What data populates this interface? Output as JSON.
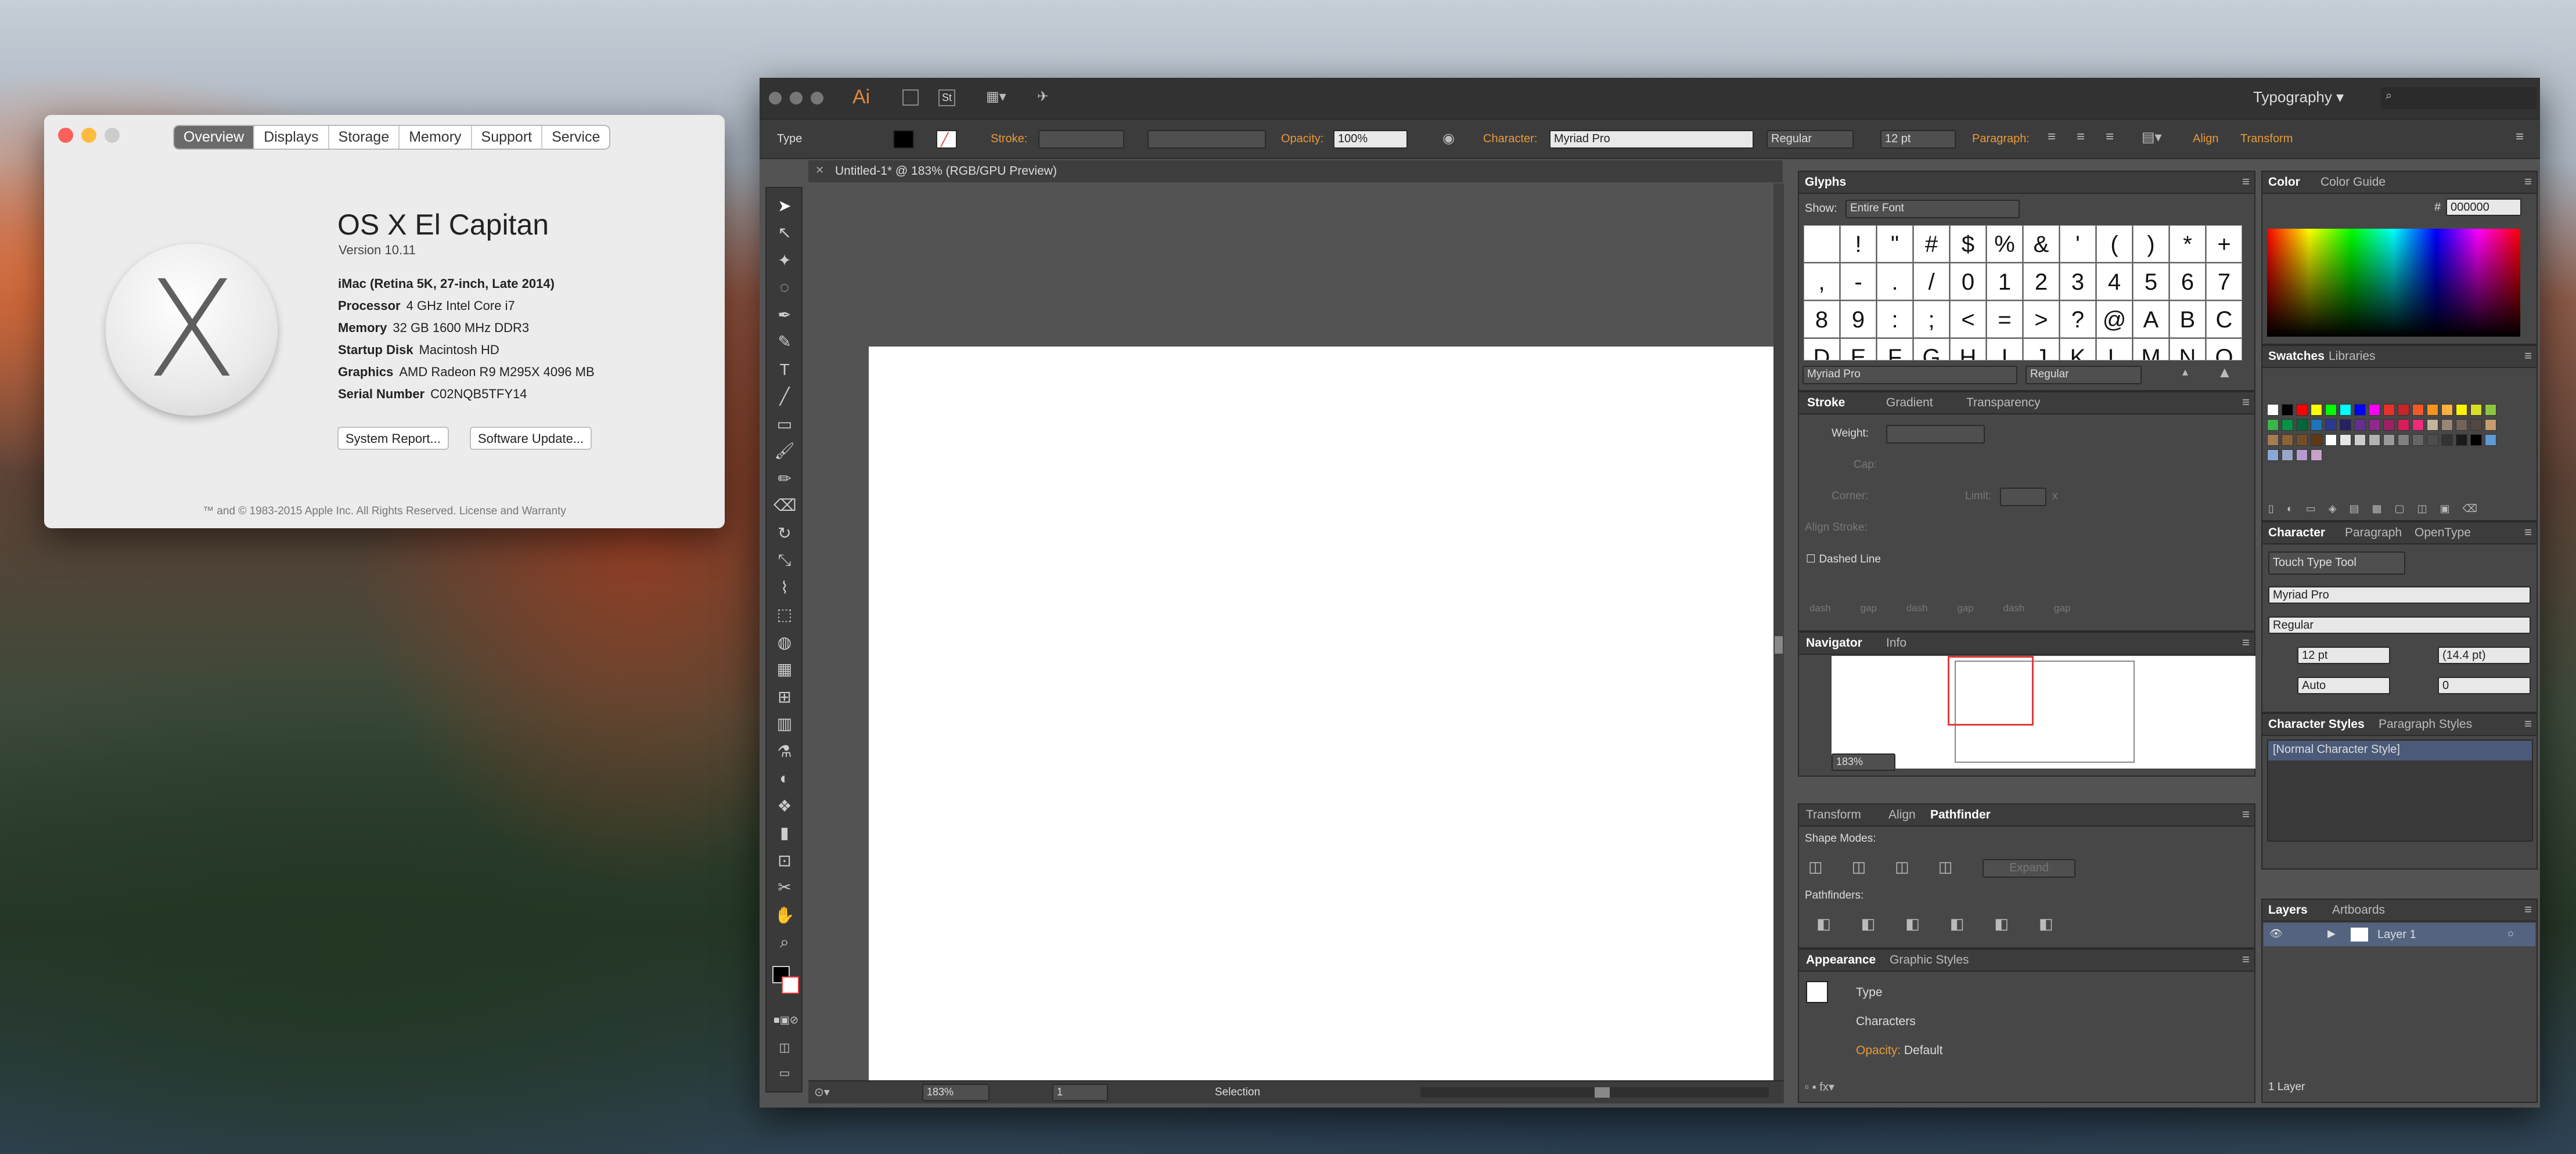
{
  "about": {
    "tabs": [
      "Overview",
      "Displays",
      "Storage",
      "Memory",
      "Support",
      "Service"
    ],
    "os_name": "OS X El Capitan",
    "version": "Version 10.11",
    "model": "iMac (Retina 5K, 27-inch, Late 2014)",
    "specs": [
      {
        "k": "Processor",
        "v": "4 GHz Intel Core i7"
      },
      {
        "k": "Memory",
        "v": "32 GB 1600 MHz DDR3"
      },
      {
        "k": "Startup Disk",
        "v": "Macintosh HD"
      },
      {
        "k": "Graphics",
        "v": "AMD Radeon R9 M295X 4096 MB"
      },
      {
        "k": "Serial Number",
        "v": "C02NQB5TFY14"
      }
    ],
    "buttons": {
      "report": "System Report...",
      "update": "Software Update..."
    },
    "logo": "X",
    "footer": "™ and © 1983-2015 Apple Inc. All Rights Reserved. License and Warranty"
  },
  "ai": {
    "logo": "Ai",
    "st": "St",
    "workspace": "Typography",
    "search_placeholder": "",
    "control": {
      "type_label": "Type",
      "stroke_label": "Stroke:",
      "opacity_label": "Opacity:",
      "opacity": "100%",
      "character_label": "Character:",
      "font": "Myriad Pro",
      "style": "Regular",
      "size": "12 pt",
      "paragraph_label": "Paragraph:",
      "align": "Align",
      "transform": "Transform"
    },
    "doc_tab": "Untitled-1* @ 183% (RGB/GPU Preview)",
    "status": {
      "zoom": "183%",
      "page": "1",
      "tool": "Selection"
    },
    "glyphs": {
      "title": "Glyphs",
      "show_label": "Show:",
      "show": "Entire Font",
      "chars": [
        "",
        "!",
        "\"",
        "#",
        "$",
        "%",
        "&",
        "'",
        "(",
        ")",
        "*",
        "+",
        ",",
        "-",
        ".",
        "/",
        "0",
        "1",
        "2",
        "3",
        "4",
        "5",
        "6",
        "7",
        "8",
        "9",
        ":",
        ";",
        "<",
        "=",
        ">",
        "?",
        "@",
        "A",
        "B",
        "C",
        "D",
        "E",
        "F",
        "G",
        "H",
        "I",
        "J",
        "K",
        "L",
        "M",
        "N",
        "O"
      ],
      "font": "Myriad Pro",
      "style": "Regular"
    },
    "stroke": {
      "tabs": [
        "Stroke",
        "Gradient",
        "Transparency"
      ],
      "weight": "Weight:",
      "cap": "Cap:",
      "corner": "Corner:",
      "limit": "Limit:",
      "limit_x": "x",
      "align": "Align Stroke:",
      "dashed": "Dashed Line",
      "dash_labels": [
        "dash",
        "gap",
        "dash",
        "gap",
        "dash",
        "gap"
      ]
    },
    "navigator": {
      "tabs": [
        "Navigator",
        "Info"
      ],
      "zoom": "183%"
    },
    "pathfinder": {
      "tabs": [
        "Transform",
        "Align",
        "Pathfinder"
      ],
      "shape_modes": "Shape Modes:",
      "expand": "Expand",
      "pathfinders": "Pathfinders:"
    },
    "appearance": {
      "tabs": [
        "Appearance",
        "Graphic Styles"
      ],
      "type": "Type",
      "characters": "Characters",
      "opacity_label": "Opacity:",
      "opacity": "Default"
    },
    "color": {
      "tabs": [
        "Color",
        "Color Guide"
      ],
      "hex_label": "#",
      "hex": "000000"
    },
    "swatches": {
      "tabs": [
        "Swatches",
        "Libraries"
      ],
      "colors": [
        "#ffffff",
        "#000000",
        "#ff0000",
        "#ffff00",
        "#00ff00",
        "#00ffff",
        "#0000ff",
        "#ff00ff",
        "#e8302a",
        "#c8252a",
        "#f05a28",
        "#f7941d",
        "#fbb040",
        "#fff200",
        "#d7df23",
        "#8dc63f",
        "#39b54a",
        "#009444",
        "#006838",
        "#1c75bc",
        "#2b3990",
        "#262262",
        "#662d91",
        "#92278f",
        "#9e1f63",
        "#da1c5c",
        "#ee2a7b",
        "#c2b59b",
        "#998675",
        "#736357",
        "#534741",
        "#c69c6d",
        "#a67c52",
        "#8c6239",
        "#754c24",
        "#603913",
        "#ffffff",
        "#e6e6e6",
        "#cccccc",
        "#b3b3b3",
        "#999999",
        "#808080",
        "#666666",
        "#4d4d4d",
        "#333333",
        "#1a1a1a",
        "#000000",
        "#5e9bd6",
        "#88a9d8",
        "#9aa6c8",
        "#b59bd0",
        "#c8a2c8"
      ]
    },
    "character": {
      "tabs": [
        "Character",
        "Paragraph",
        "OpenType"
      ],
      "touch": "Touch Type Tool",
      "font": "Myriad Pro",
      "style": "Regular",
      "size": "12 pt",
      "leading": "(14.4 pt)",
      "kerning": "Auto",
      "tracking": "0"
    },
    "char_styles": {
      "tabs": [
        "Character Styles",
        "Paragraph Styles"
      ],
      "item": "[Normal Character Style]"
    },
    "layers": {
      "tabs": [
        "Layers",
        "Artboards"
      ],
      "layer": "Layer 1",
      "count": "1 Layer"
    }
  }
}
